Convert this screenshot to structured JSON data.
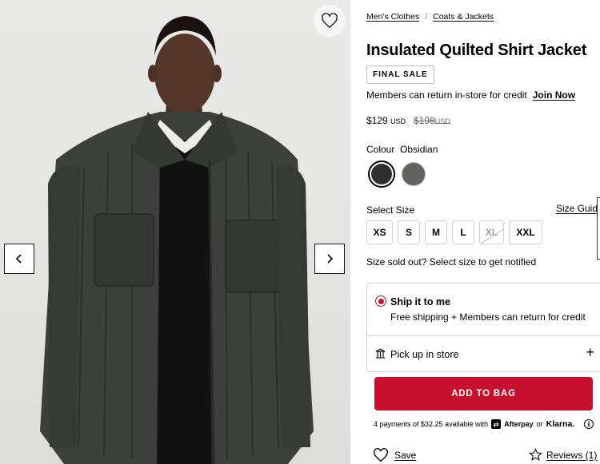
{
  "gallery": {
    "favorite_icon": "heart-icon",
    "prev_icon": "chevron-left-icon",
    "next_icon": "chevron-right-icon"
  },
  "breadcrumb": {
    "items": [
      "Men's Clothes",
      "Coats & Jackets"
    ],
    "separator": "/"
  },
  "product": {
    "title": "Insulated Quilted Shirt Jacket",
    "badge": "FINAL SALE",
    "members_text": "Members can return in-store for credit",
    "join_label": "Join Now",
    "price": "$129",
    "price_currency": "USD",
    "original_price": "$198",
    "original_currency": "USD"
  },
  "colour": {
    "label": "Colour",
    "selected": "Obsidian",
    "swatches": [
      "#2e2f2e",
      "#62635e"
    ]
  },
  "size": {
    "label": "Select Size",
    "guide_label": "Size Guid",
    "options": [
      "XS",
      "S",
      "M",
      "L",
      "XL",
      "XXL"
    ],
    "sold_out": [
      "XL"
    ],
    "sold_out_note": "Size sold out? Select size to get notified"
  },
  "fulfillment": {
    "ship_title": "Ship it to me",
    "ship_subtitle": "Free shipping + Members can return for credit",
    "pickup_title": "Pick up in store",
    "expand_symbol": "+"
  },
  "cta": {
    "add_to_bag": "ADD TO BAG"
  },
  "payments": {
    "text": "4 payments of $32.25 available with",
    "afterpay": "Afterpay",
    "or": "or",
    "klarna": "Klarna."
  },
  "actions": {
    "save_label": "Save",
    "reviews_label": "Reviews (1)"
  },
  "colors": {
    "accent": "#c8102e",
    "text": "#000000"
  }
}
